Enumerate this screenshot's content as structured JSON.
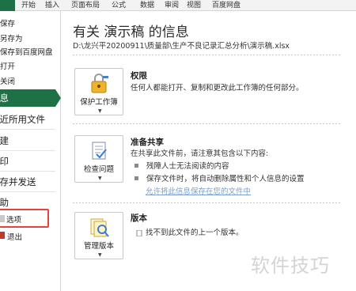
{
  "ribbon": {
    "tabs": [
      "开始",
      "插入",
      "页面布局",
      "公式",
      "数据",
      "审阅",
      "视图",
      "百度网盘"
    ]
  },
  "backstage_nav": {
    "items": [
      {
        "label": "保存"
      },
      {
        "label": "另存为"
      },
      {
        "label": "保存到百度网盘"
      },
      {
        "label": "打开"
      },
      {
        "label": "关闭"
      },
      {
        "label": "信息"
      },
      {
        "label": "最近所用文件"
      },
      {
        "label": "新建"
      },
      {
        "label": "打印"
      },
      {
        "label": "保存并发送"
      },
      {
        "label": "帮助"
      },
      {
        "label": "选项"
      },
      {
        "label": "退出"
      }
    ]
  },
  "info": {
    "title": "有关 演示稿 的信息",
    "path": "D:\\龙兴平20200911\\质量部\\生产不良记录汇总分析\\演示稿.xlsx"
  },
  "permissions": {
    "button_label": "保护工作簿",
    "heading": "权限",
    "description": "任何人都能打开、复制和更改此工作簿的任何部分。"
  },
  "prepare": {
    "button_label": "检查问题",
    "heading": "准备共享",
    "intro": "在共享此文件前，请注意其包含以下内容:",
    "bullets": [
      "残障人士无法阅读的内容",
      "保存文件时，将自动删除属性和个人信息的设置"
    ],
    "link": "允许将此信息保存在您的文件中"
  },
  "versions": {
    "button_label": "管理版本",
    "heading": "版本",
    "description": "找不到此文件的上一个版本。"
  },
  "watermark": "软件技巧",
  "colors": {
    "accent_green": "#1e7145",
    "highlight_red": "#e8423d",
    "link_blue": "#7a9fc8"
  }
}
